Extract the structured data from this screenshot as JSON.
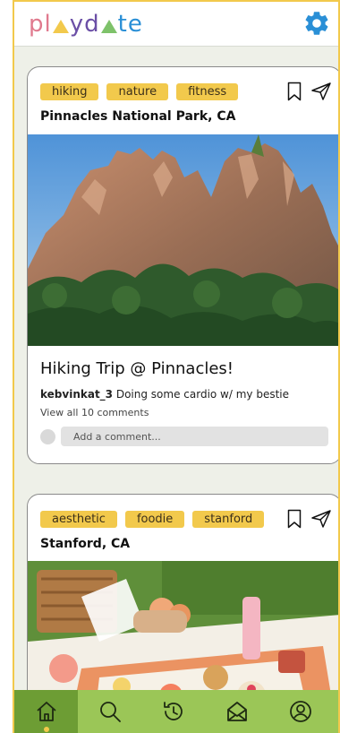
{
  "app": {
    "logo": {
      "p1": "pl",
      "p2": "yd",
      "p3": "te"
    },
    "colors": {
      "accent": "#f2c94c",
      "nav": "#9bc657",
      "nav_active": "#6d9d34"
    }
  },
  "header": {
    "settings_icon": "gear-icon"
  },
  "posts": [
    {
      "tags": [
        "hiking",
        "nature",
        "fitness"
      ],
      "location": "Pinnacles National Park, CA",
      "title": "Hiking Trip @ Pinnacles!",
      "author": "kebvinkat_3",
      "caption": " Doing some cardio w/ my bestie",
      "comments_link": "View all 10 comments",
      "comment_placeholder": "Add a comment..."
    },
    {
      "tags": [
        "aesthetic",
        "foodie",
        "stanford"
      ],
      "location": "Stanford, CA"
    }
  ],
  "nav": {
    "items": [
      "home-icon",
      "search-icon",
      "history-icon",
      "inbox-icon",
      "profile-icon"
    ],
    "active": "home-icon"
  }
}
